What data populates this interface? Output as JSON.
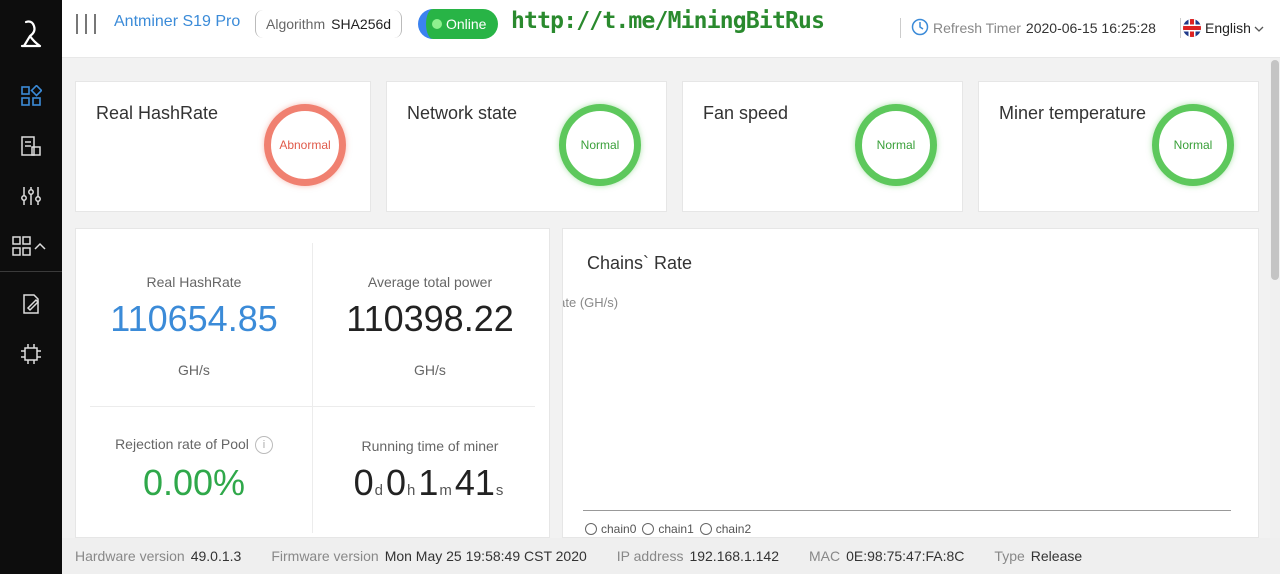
{
  "header": {
    "model": "Antminer S19 Pro",
    "algorithm_label": "Algorithm",
    "algorithm_value": "SHA256d",
    "status": "Online",
    "url": "http://t.me/MiningBitRus",
    "refresh_label": "Refresh Timer",
    "refresh_value": "2020-06-15 16:25:28",
    "language": "English"
  },
  "sidebar": {
    "icons": [
      "logo-icon",
      "dashboard-icon",
      "list-icon",
      "settings-sliders-icon",
      "apps-icon",
      "edit-icon",
      "chip-icon"
    ]
  },
  "status_cards": [
    {
      "title": "Real HashRate",
      "status": "Abnormal",
      "color": "#f08070"
    },
    {
      "title": "Network state",
      "status": "Normal",
      "color": "#5dc85c"
    },
    {
      "title": "Fan speed",
      "status": "Normal",
      "color": "#5dc85c"
    },
    {
      "title": "Miner temperature",
      "status": "Normal",
      "color": "#5dc85c"
    }
  ],
  "stats": {
    "real_hashrate": {
      "label": "Real HashRate",
      "value": "110654.85",
      "unit": "GH/s",
      "color": "#3b8bd8"
    },
    "avg_power": {
      "label": "Average total power",
      "value": "110398.22",
      "unit": "GH/s"
    },
    "rejection": {
      "label": "Rejection rate of Pool",
      "value": "0.00%",
      "color": "#2fa84a"
    },
    "runtime": {
      "label": "Running time of miner",
      "days": "0",
      "d": "d",
      "hours": "0",
      "h": "h",
      "minutes": "1",
      "m": "m",
      "seconds": "41",
      "s": "s"
    }
  },
  "chains": {
    "title": "Chains` Rate",
    "ylabel": "n rate (GH/s)",
    "legend": [
      "chain0",
      "chain1",
      "chain2"
    ]
  },
  "footer": {
    "hardware_label": "Hardware version",
    "hardware_value": "49.0.1.3",
    "firmware_label": "Firmware version",
    "firmware_value": "Mon May 25 19:58:49 CST 2020",
    "ip_label": "IP address",
    "ip_value": "192.168.1.142",
    "mac_label": "MAC",
    "mac_value": "0E:98:75:47:FA:8C",
    "type_label": "Type",
    "type_value": "Release"
  }
}
